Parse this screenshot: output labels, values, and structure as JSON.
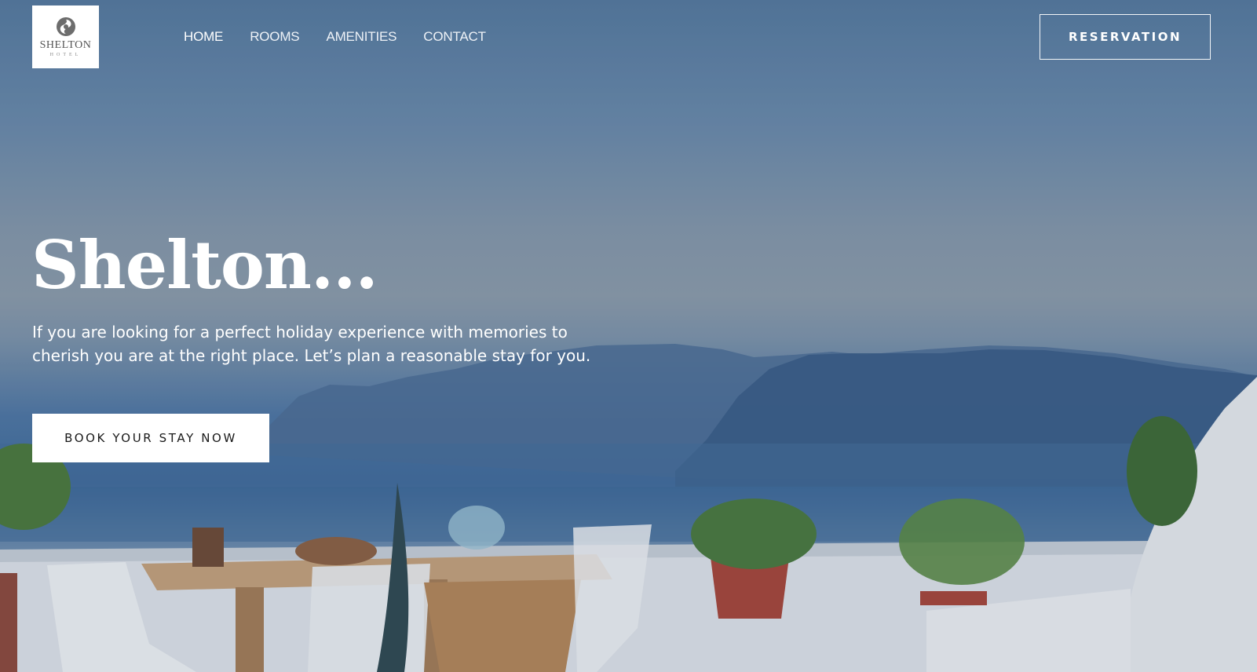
{
  "brand": {
    "name": "SHELTON",
    "sub": "HOTEL"
  },
  "nav": {
    "items": [
      {
        "label": "HOME"
      },
      {
        "label": "ROOMS"
      },
      {
        "label": "AMENITIES"
      },
      {
        "label": "CONTACT"
      }
    ]
  },
  "header": {
    "reservation_label": "RESERVATION"
  },
  "hero": {
    "title": "Shelton...",
    "description": "If you are looking for a perfect holiday experience with memories to cherish you are at the right place. Let’s plan a reasonable stay for you.",
    "cta_label": "BOOK YOUR STAY NOW"
  },
  "colors": {
    "accent": "#ffffff",
    "sky": "#6a8aab",
    "sea": "#3f6b9b",
    "cliffs": "#3e5f8a"
  }
}
